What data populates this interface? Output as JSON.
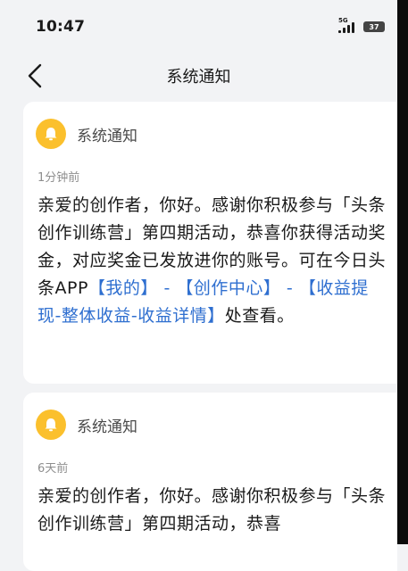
{
  "status_bar": {
    "time": "10:47",
    "network": "5G",
    "battery": "37"
  },
  "nav": {
    "title": "系统通知"
  },
  "notifications": [
    {
      "sender": "系统通知",
      "time": "1分钟前",
      "text_intro": "亲爱的创作者，你好。感谢你积极参与「头条创作训练营」第四期活动，恭喜你获得活动奖金，对应奖金已发放进你的账号。可在今日头条APP",
      "link_1": "【我的】",
      "sep_1": " - ",
      "link_2": "【创作中心】",
      "sep_2": " - ",
      "link_3": "【收益提现-整体收益-收益详情】",
      "text_outro": "处查看。"
    },
    {
      "sender": "系统通知",
      "time": "6天前",
      "text_intro": "亲爱的创作者，你好。感谢你积极参与「头条创作训练营」第四期活动，恭喜"
    }
  ],
  "colors": {
    "link": "#2f6fd0",
    "bell": "#fbc02d",
    "background": "#f2f3f5"
  }
}
